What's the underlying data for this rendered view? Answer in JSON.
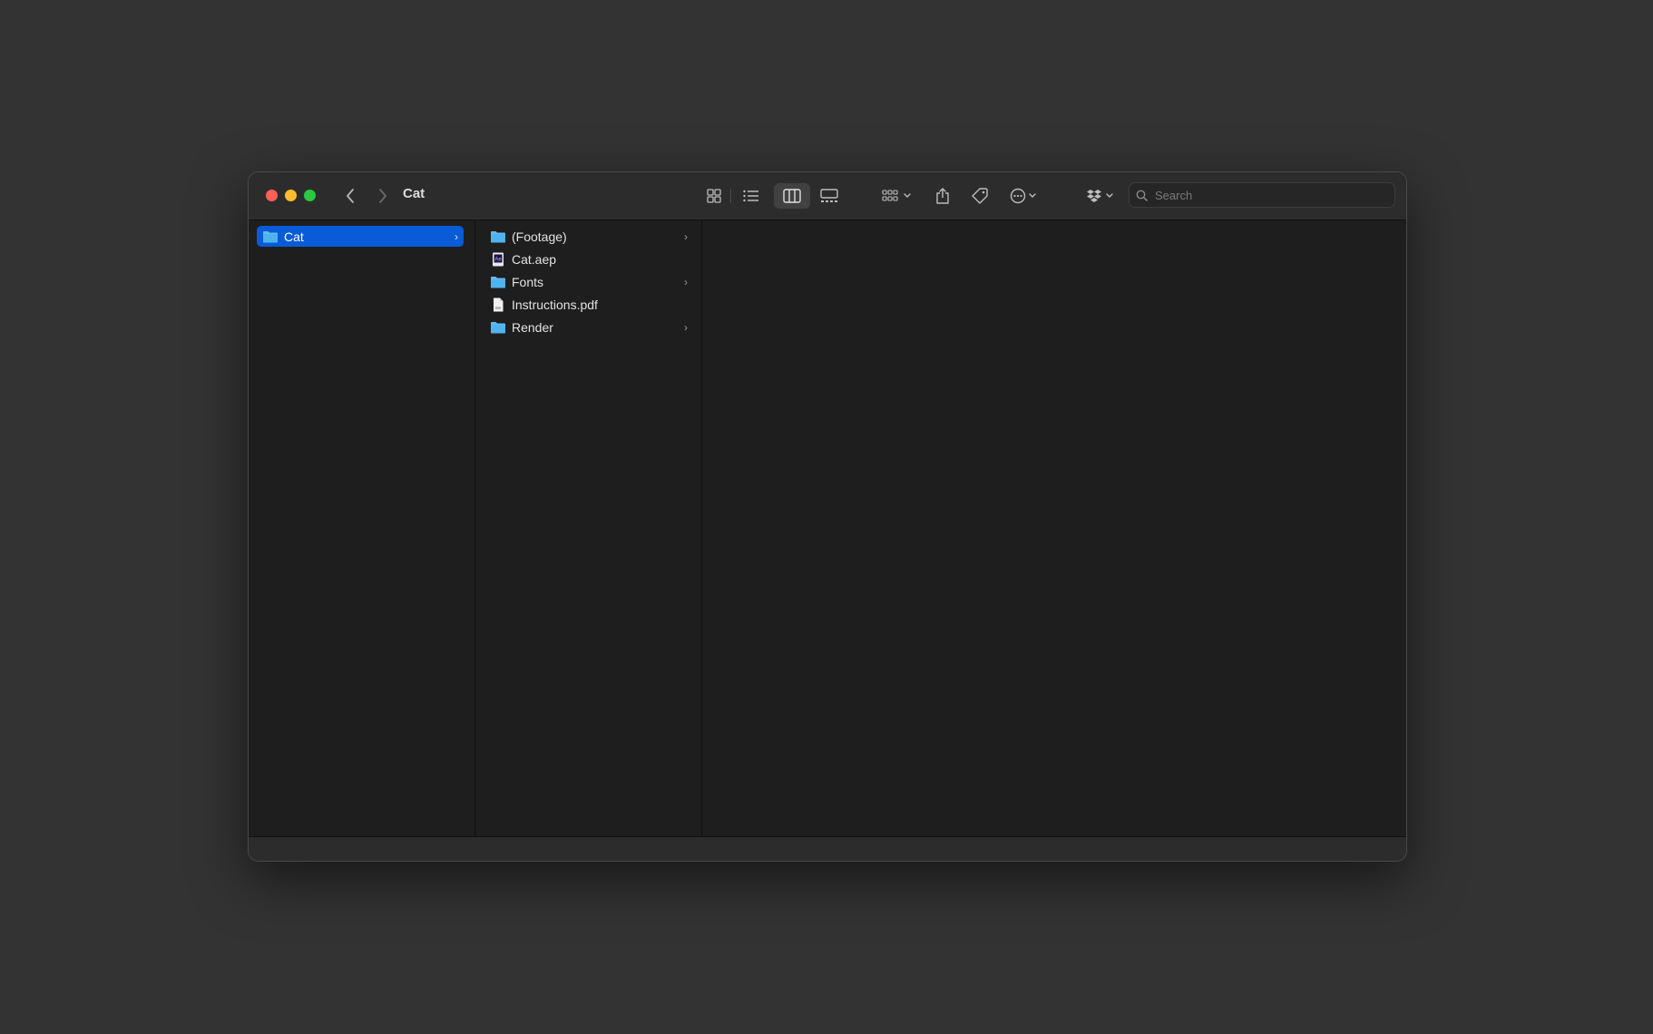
{
  "window": {
    "title": "Cat"
  },
  "toolbar": {
    "back_icon": "chevron-left-icon",
    "forward_icon": "chevron-right-icon",
    "views": [
      "icon-view",
      "list-view",
      "column-view",
      "gallery-view"
    ],
    "selected_view": "column-view",
    "group_icon": "group-by-icon",
    "share_icon": "share-icon",
    "tag_icon": "tag-icon",
    "more_icon": "ellipsis-circle-icon",
    "dropbox_icon": "dropbox-icon"
  },
  "search": {
    "placeholder": "Search",
    "value": ""
  },
  "columns": {
    "col1": [
      {
        "label": "Cat",
        "type": "folder",
        "has_children": true,
        "selected": true
      }
    ],
    "col2": [
      {
        "label": "(Footage)",
        "type": "folder",
        "has_children": true
      },
      {
        "label": "Cat.aep",
        "type": "aep",
        "has_children": false
      },
      {
        "label": "Fonts",
        "type": "folder",
        "has_children": true
      },
      {
        "label": "Instructions.pdf",
        "type": "document",
        "has_children": false
      },
      {
        "label": "Render",
        "type": "folder",
        "has_children": true
      }
    ]
  },
  "colors": {
    "selection": "#0a5bd7",
    "folder": "#4fb3ee",
    "close": "#fe5f57",
    "minimize": "#febc2e",
    "maximize": "#28c840"
  },
  "chevron_glyph": "›"
}
